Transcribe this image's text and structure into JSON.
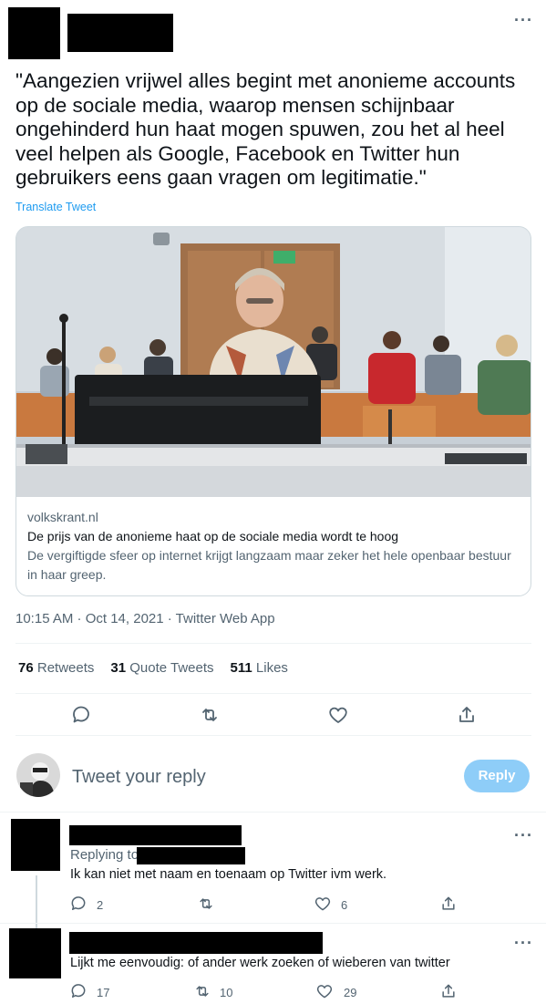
{
  "tweet": {
    "text": "\"Aangezien vrijwel alles begint met anonieme accounts op de sociale media, waarop mensen schijnbaar ongehinderd hun haat mogen spuwen, zou het al heel veel helpen als Google, Facebook en Twitter hun gebruikers eens gaan vragen om legitimatie.\"",
    "translate_label": "Translate Tweet",
    "more_icon": "more-icon",
    "card": {
      "domain": "volkskrant.nl",
      "title": "De prijs van de anonieme haat op de sociale media wordt te hoog",
      "description": "De vergiftigde sfeer op internet krijgt langzaam maar zeker het hele openbaar bestuur in haar greep."
    },
    "timestamp": "10:15 AM · Oct 14, 2021 · Twitter Web App",
    "stats": {
      "retweets_count": "76",
      "retweets_label": "Retweets",
      "quotes_count": "31",
      "quotes_label": "Quote Tweets",
      "likes_count": "511",
      "likes_label": "Likes"
    },
    "actions": [
      "reply-icon",
      "retweet-icon",
      "like-icon",
      "share-icon"
    ]
  },
  "composer": {
    "placeholder": "Tweet your reply",
    "button_label": "Reply"
  },
  "replies": [
    {
      "replying_label": "Replying to",
      "text": "Ik kan niet met naam en toenaam op Twitter ivm werk.",
      "reply_count": "2",
      "retweet_count": "",
      "like_count": "6"
    },
    {
      "text": "Lijkt me eenvoudig: of ander werk zoeken of wieberen van twitter",
      "reply_count": "17",
      "retweet_count": "10",
      "like_count": "29"
    }
  ],
  "colors": {
    "accent": "#1d9bf0",
    "reply_button": "#8ecdf8",
    "muted_text": "#536471",
    "border": "#cfd9de"
  }
}
